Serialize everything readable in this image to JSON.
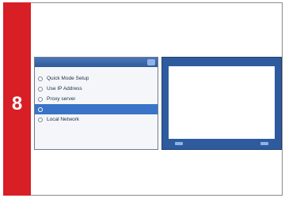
{
  "step": {
    "number": "8"
  },
  "left_screen": {
    "title": "",
    "items": [
      {
        "label": "Quick Mode Setup",
        "selected": false
      },
      {
        "label": "Use IP Address",
        "selected": false
      },
      {
        "label": "Proxy server",
        "selected": false
      },
      {
        "label": "",
        "selected": true
      },
      {
        "label": "Local Network",
        "selected": false
      }
    ]
  },
  "right_screen": {
    "title": "",
    "lines": [
      "",
      "",
      "",
      "",
      "",
      "",
      "",
      "",
      ""
    ]
  },
  "colors": {
    "step_bar": "#d81f26",
    "selection": "#3a74c8",
    "screen_header": "#2f5a9c"
  }
}
